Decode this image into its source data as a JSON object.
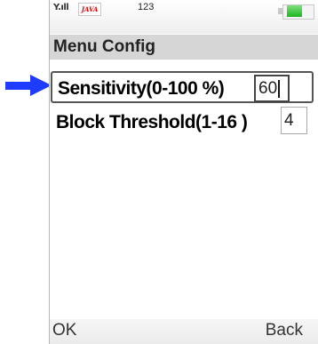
{
  "status_bar": {
    "signal": "Y.ıll",
    "java_logo": "JAVA",
    "number": "123",
    "battery_level": 0.5
  },
  "title": "Menu Config",
  "rows": [
    {
      "label": "Sensitivity(0-100 %)",
      "value": "60"
    },
    {
      "label": "Block Threshold(1-16 )",
      "value": "4"
    }
  ],
  "softkeys": {
    "left": "OK",
    "right": "Back"
  },
  "colors": {
    "pointer_arrow": "#1e3cff",
    "title_bar": "#d6d6d6",
    "battery_fill": "#1fb41f"
  },
  "icons": {
    "pointer": "blue-arrow-pointer"
  }
}
